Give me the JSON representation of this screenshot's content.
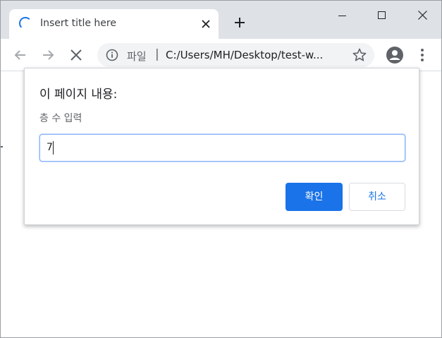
{
  "tab": {
    "title": "Insert title here",
    "close_icon": "close-icon"
  },
  "toolbar": {
    "scheme_label": "파일",
    "separator": "|",
    "url": "C:/Users/MH/Desktop/test-w..."
  },
  "dialog": {
    "title": "이 페이지 내용:",
    "message": "층 수 입력",
    "input_value": "7",
    "ok_label": "확인",
    "cancel_label": "취소"
  },
  "colors": {
    "accent": "#1a73e8",
    "tabstrip": "#dee1e6",
    "omnibox": "#f1f3f4"
  }
}
